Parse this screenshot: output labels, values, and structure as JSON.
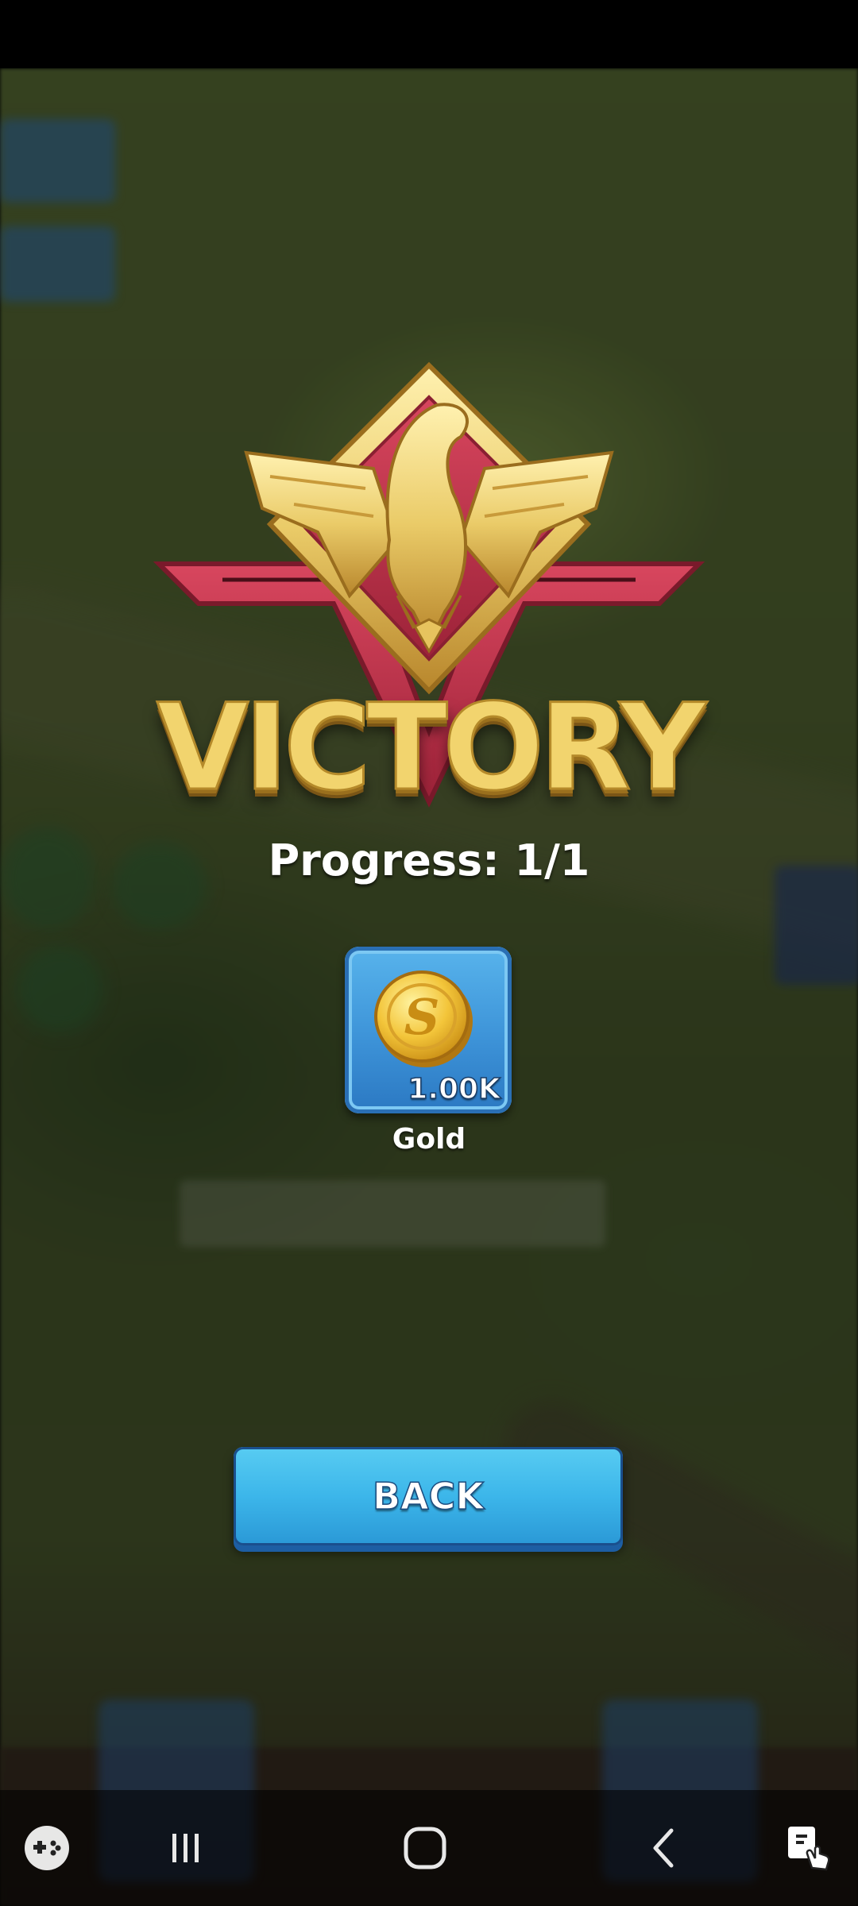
{
  "victory": {
    "title": "VICTORY",
    "progress": "Progress: 1/1"
  },
  "reward": {
    "amount": "1.00K",
    "label": "Gold",
    "icon": "gold-coin-icon"
  },
  "actions": {
    "back_label": "BACK"
  },
  "nav": {
    "items": [
      "game-tools-icon",
      "recent-apps-icon",
      "home-icon",
      "back-icon",
      "screen-touch-icon"
    ]
  },
  "colors": {
    "gold": "#f2d46e",
    "crimson": "#c8344f",
    "button_blue": "#3cb6ea",
    "card_blue": "#3d93d8"
  }
}
